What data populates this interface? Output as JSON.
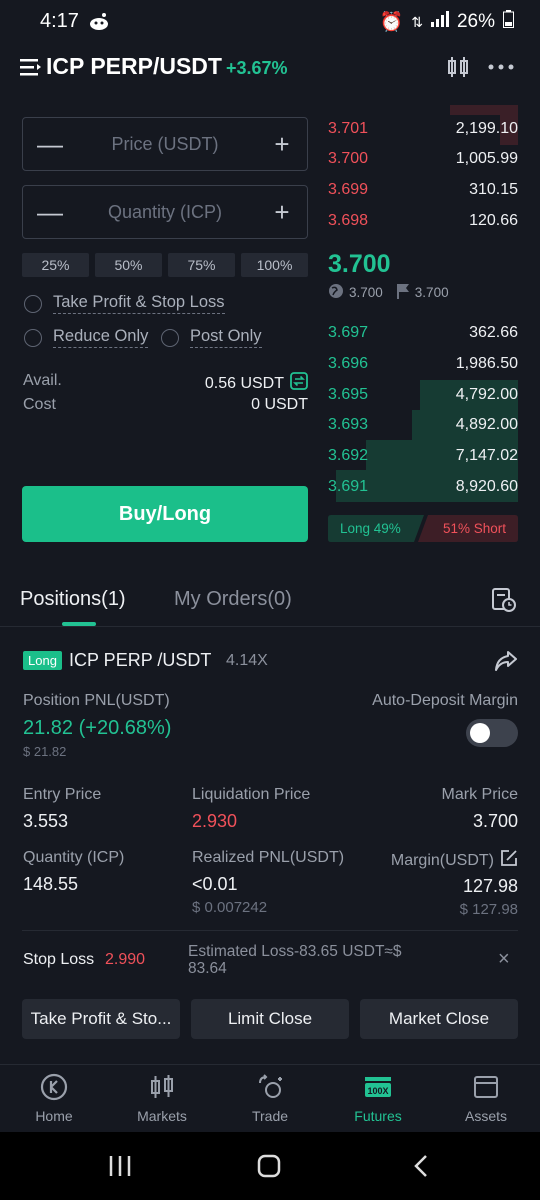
{
  "status_bar": {
    "time": "4:17",
    "battery": "26%"
  },
  "header": {
    "pair": "ICP PERP/USDT",
    "change": "+3.67%"
  },
  "form": {
    "price_placeholder": "Price (USDT)",
    "quantity_placeholder": "Quantity (ICP)",
    "minus": "—",
    "plus": "+",
    "percents": [
      "25%",
      "50%",
      "75%",
      "100%"
    ],
    "tp_sl_label": "Take Profit & Stop Loss",
    "reduce_only_label": "Reduce Only",
    "post_only_label": "Post Only",
    "avail_label": "Avail.",
    "avail_value": "0.56 USDT",
    "cost_label": "Cost",
    "cost_value": "0 USDT",
    "buy_label": "Buy/Long"
  },
  "order_book": {
    "asks": [
      {
        "price": "3.701",
        "amount": "2,199.10"
      },
      {
        "price": "3.700",
        "amount": "1,005.99"
      },
      {
        "price": "3.699",
        "amount": "310.15"
      },
      {
        "price": "3.698",
        "amount": "120.66"
      }
    ],
    "last_price": "3.700",
    "index_price": "3.700",
    "mark_price": "3.700",
    "bids": [
      {
        "price": "3.697",
        "amount": "362.66"
      },
      {
        "price": "3.696",
        "amount": "1,986.50"
      },
      {
        "price": "3.695",
        "amount": "4,792.00"
      },
      {
        "price": "3.693",
        "amount": "4,892.00"
      },
      {
        "price": "3.692",
        "amount": "7,147.02"
      },
      {
        "price": "3.691",
        "amount": "8,920.60"
      }
    ],
    "long_ratio": "Long 49%",
    "short_ratio": "51% Short"
  },
  "tabs": {
    "positions": "Positions(1)",
    "orders": "My Orders(0)"
  },
  "position": {
    "side": "Long",
    "pair": "ICP PERP /USDT",
    "leverage": "4.14X",
    "pnl_label": "Position PNL(USDT)",
    "pnl_value": "21.82 (+20.68%)",
    "pnl_usd": "$ 21.82",
    "auto_deposit_label": "Auto-Deposit Margin",
    "auto_deposit_on": false,
    "entry_label": "Entry Price",
    "entry_value": "3.553",
    "liq_label": "Liquidation Price",
    "liq_value": "2.930",
    "mark_label": "Mark Price",
    "mark_value": "3.700",
    "qty_label": "Quantity (ICP)",
    "qty_value": "148.55",
    "rpnl_label": "Realized PNL(USDT)",
    "rpnl_value": "<0.01",
    "rpnl_usd": "$ 0.007242",
    "margin_label": "Margin(USDT)",
    "margin_value": "127.98",
    "margin_usd": "$ 127.98",
    "sl_label": "Stop Loss",
    "sl_value": "2.990",
    "est_loss": "Estimated Loss-83.65 USDT≈$ 83.64",
    "close_x": "×",
    "btn_tpsl": "Take Profit & Sto...",
    "btn_limit": "Limit Close",
    "btn_market": "Market Close"
  },
  "nav": [
    {
      "label": "Home",
      "icon": "home-k-icon"
    },
    {
      "label": "Markets",
      "icon": "markets-candle-icon"
    },
    {
      "label": "Trade",
      "icon": "trade-swap-icon"
    },
    {
      "label": "Futures",
      "icon": "futures-100x-icon"
    },
    {
      "label": "Assets",
      "icon": "wallet-icon"
    }
  ],
  "colors": {
    "green": "#22c293",
    "red": "#f0515a",
    "bg": "#151820"
  }
}
